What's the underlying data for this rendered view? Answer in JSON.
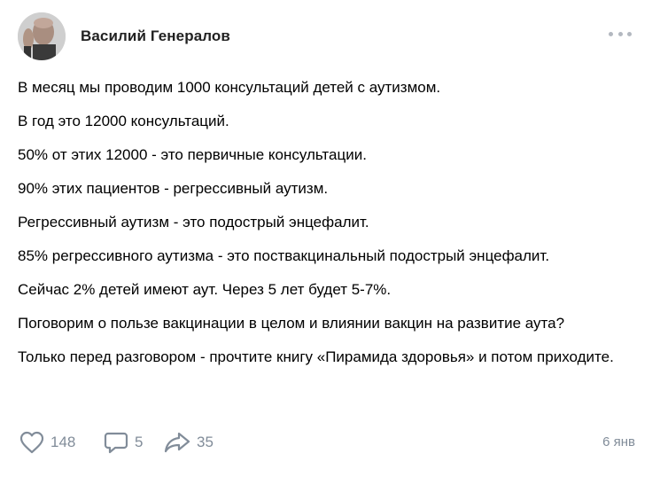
{
  "post": {
    "author": "Василий Генералов",
    "avatar_icon": "person-photo",
    "more_icon": "more-horizontal-icon",
    "paragraphs": [
      "В месяц мы проводим 1000 консультаций детей с аутизмом.",
      "В год это 12000 консультаций.",
      "50% от этих 12000 - это первичные консультации.",
      "90% этих пациентов - регрессивный аутизм.",
      "Регрессивный аутизм - это подострый энцефалит.",
      "85% регрессивного аутизма - это поствакцинальный подострый энцефалит.",
      "Сейчас 2% детей имеют аут. Через 5 лет будет 5-7%.",
      "Поговорим о пользе вакцинации в целом и влиянии вакцин на развитие аута?",
      "Только перед разговором - прочтите книгу «Пирамида здоровья» и потом приходите."
    ],
    "footer": {
      "likes": "148",
      "comments": "5",
      "shares": "35",
      "date": "6 янв"
    }
  },
  "colors": {
    "meta": "#818c99",
    "dots": "#b3b8c0",
    "text": "#000000"
  }
}
